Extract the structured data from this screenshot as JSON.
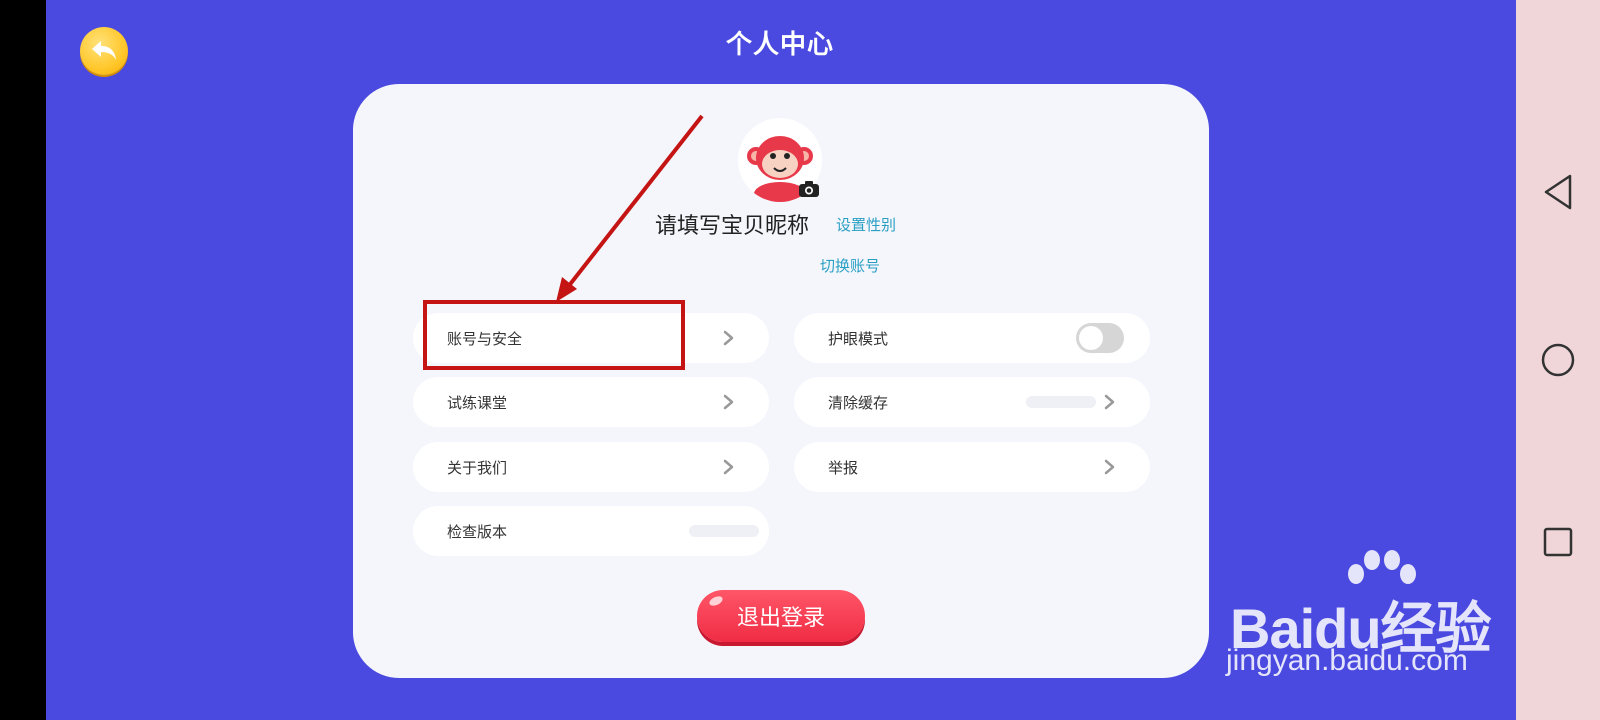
{
  "header": {
    "title": "个人中心",
    "back_icon": "back-arrow-icon"
  },
  "profile": {
    "nickname_placeholder": "请填写宝贝昵称",
    "set_gender_label": "设置性别",
    "switch_account_label": "切换账号",
    "avatar_icon": "monkey-avatar",
    "camera_icon": "camera-icon"
  },
  "settings": {
    "left": [
      {
        "label": "账号与安全"
      },
      {
        "label": "试练课堂"
      },
      {
        "label": "关于我们"
      },
      {
        "label": "检查版本"
      }
    ],
    "right": [
      {
        "label": "护眼模式",
        "toggle_on": false
      },
      {
        "label": "清除缓存"
      },
      {
        "label": "举报"
      }
    ]
  },
  "logout_label": "退出登录",
  "colors": {
    "background": "#4a4ae0",
    "card": "#f4f6fb",
    "link": "#2a9fc4",
    "logout": "#f02c44",
    "annotation": "#c41414"
  },
  "system_nav": {
    "back": "triangle-back-icon",
    "home": "circle-home-icon",
    "recents": "square-recents-icon"
  },
  "watermark": {
    "brand": "Baidu经验",
    "url": "jingyan.baidu.com"
  }
}
